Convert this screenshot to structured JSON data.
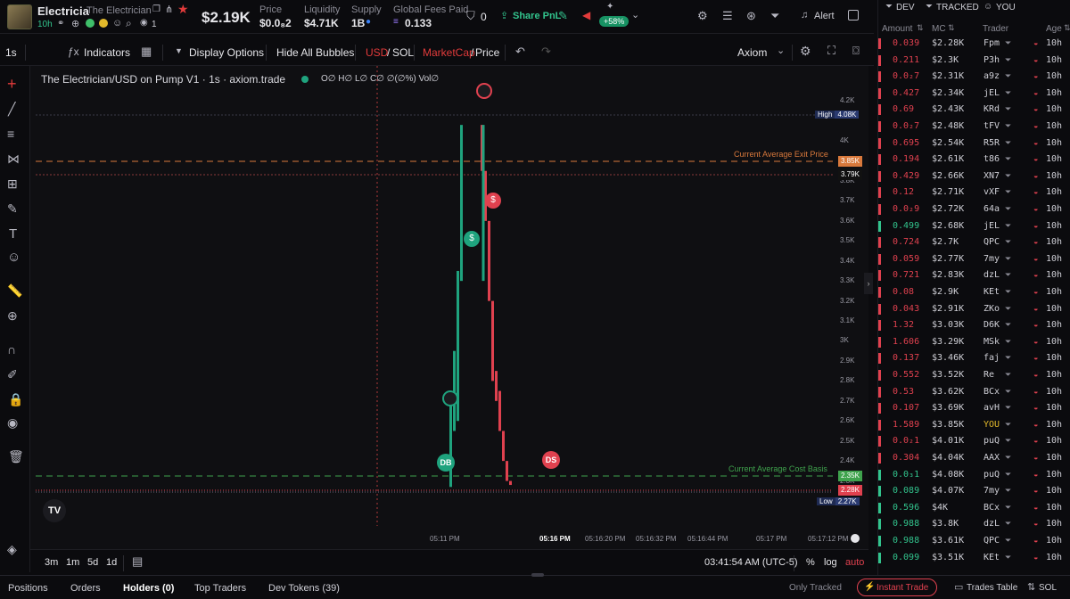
{
  "header": {
    "token_symbol": "Electricia",
    "token_name": "The Electrician",
    "age": "10h",
    "holders_count": "1",
    "market_cap": "$2.19K",
    "price_label": "Price",
    "price_value": "$0.0₈2",
    "liquidity_label": "Liquidity",
    "liquidity_value": "$4.71K",
    "supply_label": "Supply",
    "supply_value": "1B",
    "fees_label": "Global Fees Paid",
    "fees_value": "0.133",
    "wallet_count": "0",
    "share_label": "Share PnL",
    "change_badge": "+58%",
    "alert_label": "Alert"
  },
  "toolbar": {
    "interval": "1s",
    "indicators_label": "Indicators",
    "display_options_label": "Display Options",
    "hide_bubbles_label": "Hide All Bubbles",
    "currency_usd": "USD",
    "currency_sol": "SOL",
    "marketcap_label": "MarketCap",
    "price_label": "Price",
    "chart_style": "Axiom"
  },
  "chart": {
    "legend_title": "The Electrician/USD on Pump V1 · 1s · axiom.trade",
    "ohlc": "O∅ H∅ L∅ C∅ ∅(∅%) Vol∅",
    "exit_label": "Current Average Exit Price",
    "cost_label": "Current Average Cost Basis",
    "badge_high_label": "High",
    "badge_high_value": "4.08K",
    "badge_exit": "3.85K",
    "badge_3_79": "3.79K",
    "badge_cost": "2.35K",
    "badge_current": "2.28K",
    "badge_low_label": "Low",
    "badge_low_value": "2.27K",
    "marker_db": "DB",
    "marker_ds": "DS",
    "y_ticks": [
      "4.2K",
      "4K",
      "3.9K",
      "3.8K",
      "3.7K",
      "3.6K",
      "3.5K",
      "3.4K",
      "3.3K",
      "3.2K",
      "3.1K",
      "3K",
      "2.9K",
      "2.8K",
      "2.7K",
      "2.6K",
      "2.5K",
      "2.4K",
      "2.3K",
      "2.2K"
    ],
    "x_ticks": [
      "05:11 PM",
      "05:16 PM",
      "05:16:20 PM",
      "05:16:32 PM",
      "05:16:44 PM",
      "05:17 PM",
      "05:17:12 PM"
    ],
    "colors": {
      "up": "#1fa37e",
      "down": "#e0414f",
      "exit": "#d9793c",
      "cost": "#3fa34d"
    }
  },
  "chart_data": {
    "type": "candlestick",
    "title": "The Electrician/USD on Pump V1",
    "ylabel": "MarketCap (USD)",
    "ylim": [
      2200,
      4250
    ],
    "levels": {
      "high": 4080,
      "low": 2270,
      "exit_avg": 3850,
      "cost_avg": 2350,
      "current": 2280
    },
    "series": [
      {
        "name": "up",
        "values": [
          [
            2270,
            2700
          ],
          [
            2550,
            2950
          ],
          [
            2600,
            3350
          ],
          [
            3300,
            4080
          ]
        ]
      },
      {
        "name": "down",
        "values": [
          [
            4080,
            3850
          ],
          [
            3850,
            3600
          ],
          [
            3600,
            3200
          ],
          [
            3200,
            2800
          ],
          [
            2850,
            2700
          ],
          [
            2750,
            2550
          ],
          [
            2550,
            2400
          ],
          [
            2400,
            2300
          ],
          [
            2300,
            2280
          ]
        ]
      }
    ]
  },
  "chart_footer": {
    "ranges": [
      "3m",
      "1m",
      "5d",
      "1d"
    ],
    "clock": "03:41:54 AM (UTC-5)",
    "percent": "%",
    "log": "log",
    "auto": "auto"
  },
  "bottom_tabs": {
    "positions": "Positions",
    "orders": "Orders",
    "holders": "Holders (0)",
    "top_traders": "Top Traders",
    "dev_tokens": "Dev Tokens (39)",
    "only_tracked": "Only Tracked",
    "instant_trade": "Instant Trade",
    "trades_table": "Trades Table",
    "sol": "SOL"
  },
  "right_panel": {
    "filters": [
      "DEV",
      "TRACKED",
      "YOU"
    ],
    "headers": [
      "Amount",
      "MC",
      "Trader",
      "Age"
    ],
    "trades": [
      {
        "amount": "0.039",
        "mc": "$2.28K",
        "trader": "Fpm",
        "age": "10h",
        "side": "sell"
      },
      {
        "amount": "0.211",
        "mc": "$2.3K",
        "trader": "P3h",
        "age": "10h",
        "side": "sell"
      },
      {
        "amount": "0.0₂7",
        "mc": "$2.31K",
        "trader": "a9z",
        "age": "10h",
        "side": "sell"
      },
      {
        "amount": "0.427",
        "mc": "$2.34K",
        "trader": "jEL",
        "age": "10h",
        "side": "sell"
      },
      {
        "amount": "0.69",
        "mc": "$2.43K",
        "trader": "KRd",
        "age": "10h",
        "side": "sell"
      },
      {
        "amount": "0.0₂7",
        "mc": "$2.48K",
        "trader": "tFV",
        "age": "10h",
        "side": "sell"
      },
      {
        "amount": "0.695",
        "mc": "$2.54K",
        "trader": "R5R",
        "age": "10h",
        "side": "sell"
      },
      {
        "amount": "0.194",
        "mc": "$2.61K",
        "trader": "t86",
        "age": "10h",
        "side": "sell"
      },
      {
        "amount": "0.429",
        "mc": "$2.66K",
        "trader": "XN7",
        "age": "10h",
        "side": "sell"
      },
      {
        "amount": "0.12",
        "mc": "$2.71K",
        "trader": "vXF",
        "age": "10h",
        "side": "sell"
      },
      {
        "amount": "0.0₂9",
        "mc": "$2.72K",
        "trader": "64a",
        "age": "10h",
        "side": "sell"
      },
      {
        "amount": "0.499",
        "mc": "$2.68K",
        "trader": "jEL",
        "age": "10h",
        "side": "buy"
      },
      {
        "amount": "0.724",
        "mc": "$2.7K",
        "trader": "QPC",
        "age": "10h",
        "side": "sell"
      },
      {
        "amount": "0.059",
        "mc": "$2.77K",
        "trader": "7my",
        "age": "10h",
        "side": "sell"
      },
      {
        "amount": "0.721",
        "mc": "$2.83K",
        "trader": "dzL",
        "age": "10h",
        "side": "sell"
      },
      {
        "amount": "0.08",
        "mc": "$2.9K",
        "trader": "KEt",
        "age": "10h",
        "side": "sell"
      },
      {
        "amount": "0.043",
        "mc": "$2.91K",
        "trader": "ZKo",
        "age": "10h",
        "side": "sell"
      },
      {
        "amount": "1.32",
        "mc": "$3.03K",
        "trader": "D6K",
        "age": "10h",
        "side": "sell"
      },
      {
        "amount": "1.606",
        "mc": "$3.29K",
        "trader": "MSk",
        "age": "10h",
        "side": "sell"
      },
      {
        "amount": "0.137",
        "mc": "$3.46K",
        "trader": "faj",
        "age": "10h",
        "side": "sell"
      },
      {
        "amount": "0.552",
        "mc": "$3.52K",
        "trader": "Re",
        "age": "10h",
        "side": "sell"
      },
      {
        "amount": "0.53",
        "mc": "$3.62K",
        "trader": "BCx",
        "age": "10h",
        "side": "sell"
      },
      {
        "amount": "0.107",
        "mc": "$3.69K",
        "trader": "avH",
        "age": "10h",
        "side": "sell"
      },
      {
        "amount": "1.589",
        "mc": "$3.85K",
        "trader": "YOU",
        "age": "10h",
        "side": "sell"
      },
      {
        "amount": "0.0₂1",
        "mc": "$4.01K",
        "trader": "puQ",
        "age": "10h",
        "side": "sell"
      },
      {
        "amount": "0.304",
        "mc": "$4.04K",
        "trader": "AAX",
        "age": "10h",
        "side": "sell"
      },
      {
        "amount": "0.0₃1",
        "mc": "$4.08K",
        "trader": "puQ",
        "age": "10h",
        "side": "buy"
      },
      {
        "amount": "0.089",
        "mc": "$4.07K",
        "trader": "7my",
        "age": "10h",
        "side": "buy"
      },
      {
        "amount": "0.596",
        "mc": "$4K",
        "trader": "BCx",
        "age": "10h",
        "side": "buy"
      },
      {
        "amount": "0.988",
        "mc": "$3.8K",
        "trader": "dzL",
        "age": "10h",
        "side": "buy"
      },
      {
        "amount": "0.988",
        "mc": "$3.61K",
        "trader": "QPC",
        "age": "10h",
        "side": "buy"
      },
      {
        "amount": "0.099",
        "mc": "$3.51K",
        "trader": "KEt",
        "age": "10h",
        "side": "buy"
      }
    ]
  }
}
